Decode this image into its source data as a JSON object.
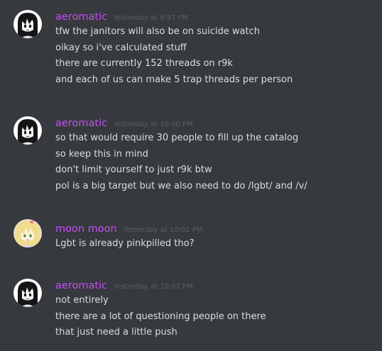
{
  "colors": {
    "background": "#36393e",
    "aeromatic_name": "#c64ef5",
    "moonmoon_name": "#c64ef5",
    "timestamp": "#5b5e63",
    "text": "#dcddde"
  },
  "messages": [
    {
      "author": "aeromatic",
      "timestamp": "Yesterday at 9:57 PM",
      "avatar_icon": "anime-girl-bw-avatar",
      "lines": [
        "tfw the janitors will also be on suicide watch",
        "oikay so i've calculated stuff",
        "there are currently 152 threads on r9k",
        "and each of us can make 5 trap threads per person"
      ]
    },
    {
      "author": "aeromatic",
      "timestamp": "Yesterday at 10:00 PM",
      "avatar_icon": "anime-girl-bw-avatar",
      "lines": [
        "so that would require 30 people to fill up the catalog",
        "so keep this in mind",
        "don't limit yourself to just r9k btw",
        "pol is a big target but we also need to do /lgbt/ and /v/"
      ]
    },
    {
      "author": "moon moon",
      "timestamp": "Yesterday at 10:02 PM",
      "avatar_icon": "anime-blonde-avatar",
      "lines": [
        "Lgbt is already pinkpilled tho?"
      ]
    },
    {
      "author": "aeromatic",
      "timestamp": "Yesterday at 10:02 PM",
      "avatar_icon": "anime-girl-bw-avatar",
      "lines": [
        "not entirely",
        "there are a lot of questioning people on there",
        "that just need a little push"
      ]
    }
  ]
}
